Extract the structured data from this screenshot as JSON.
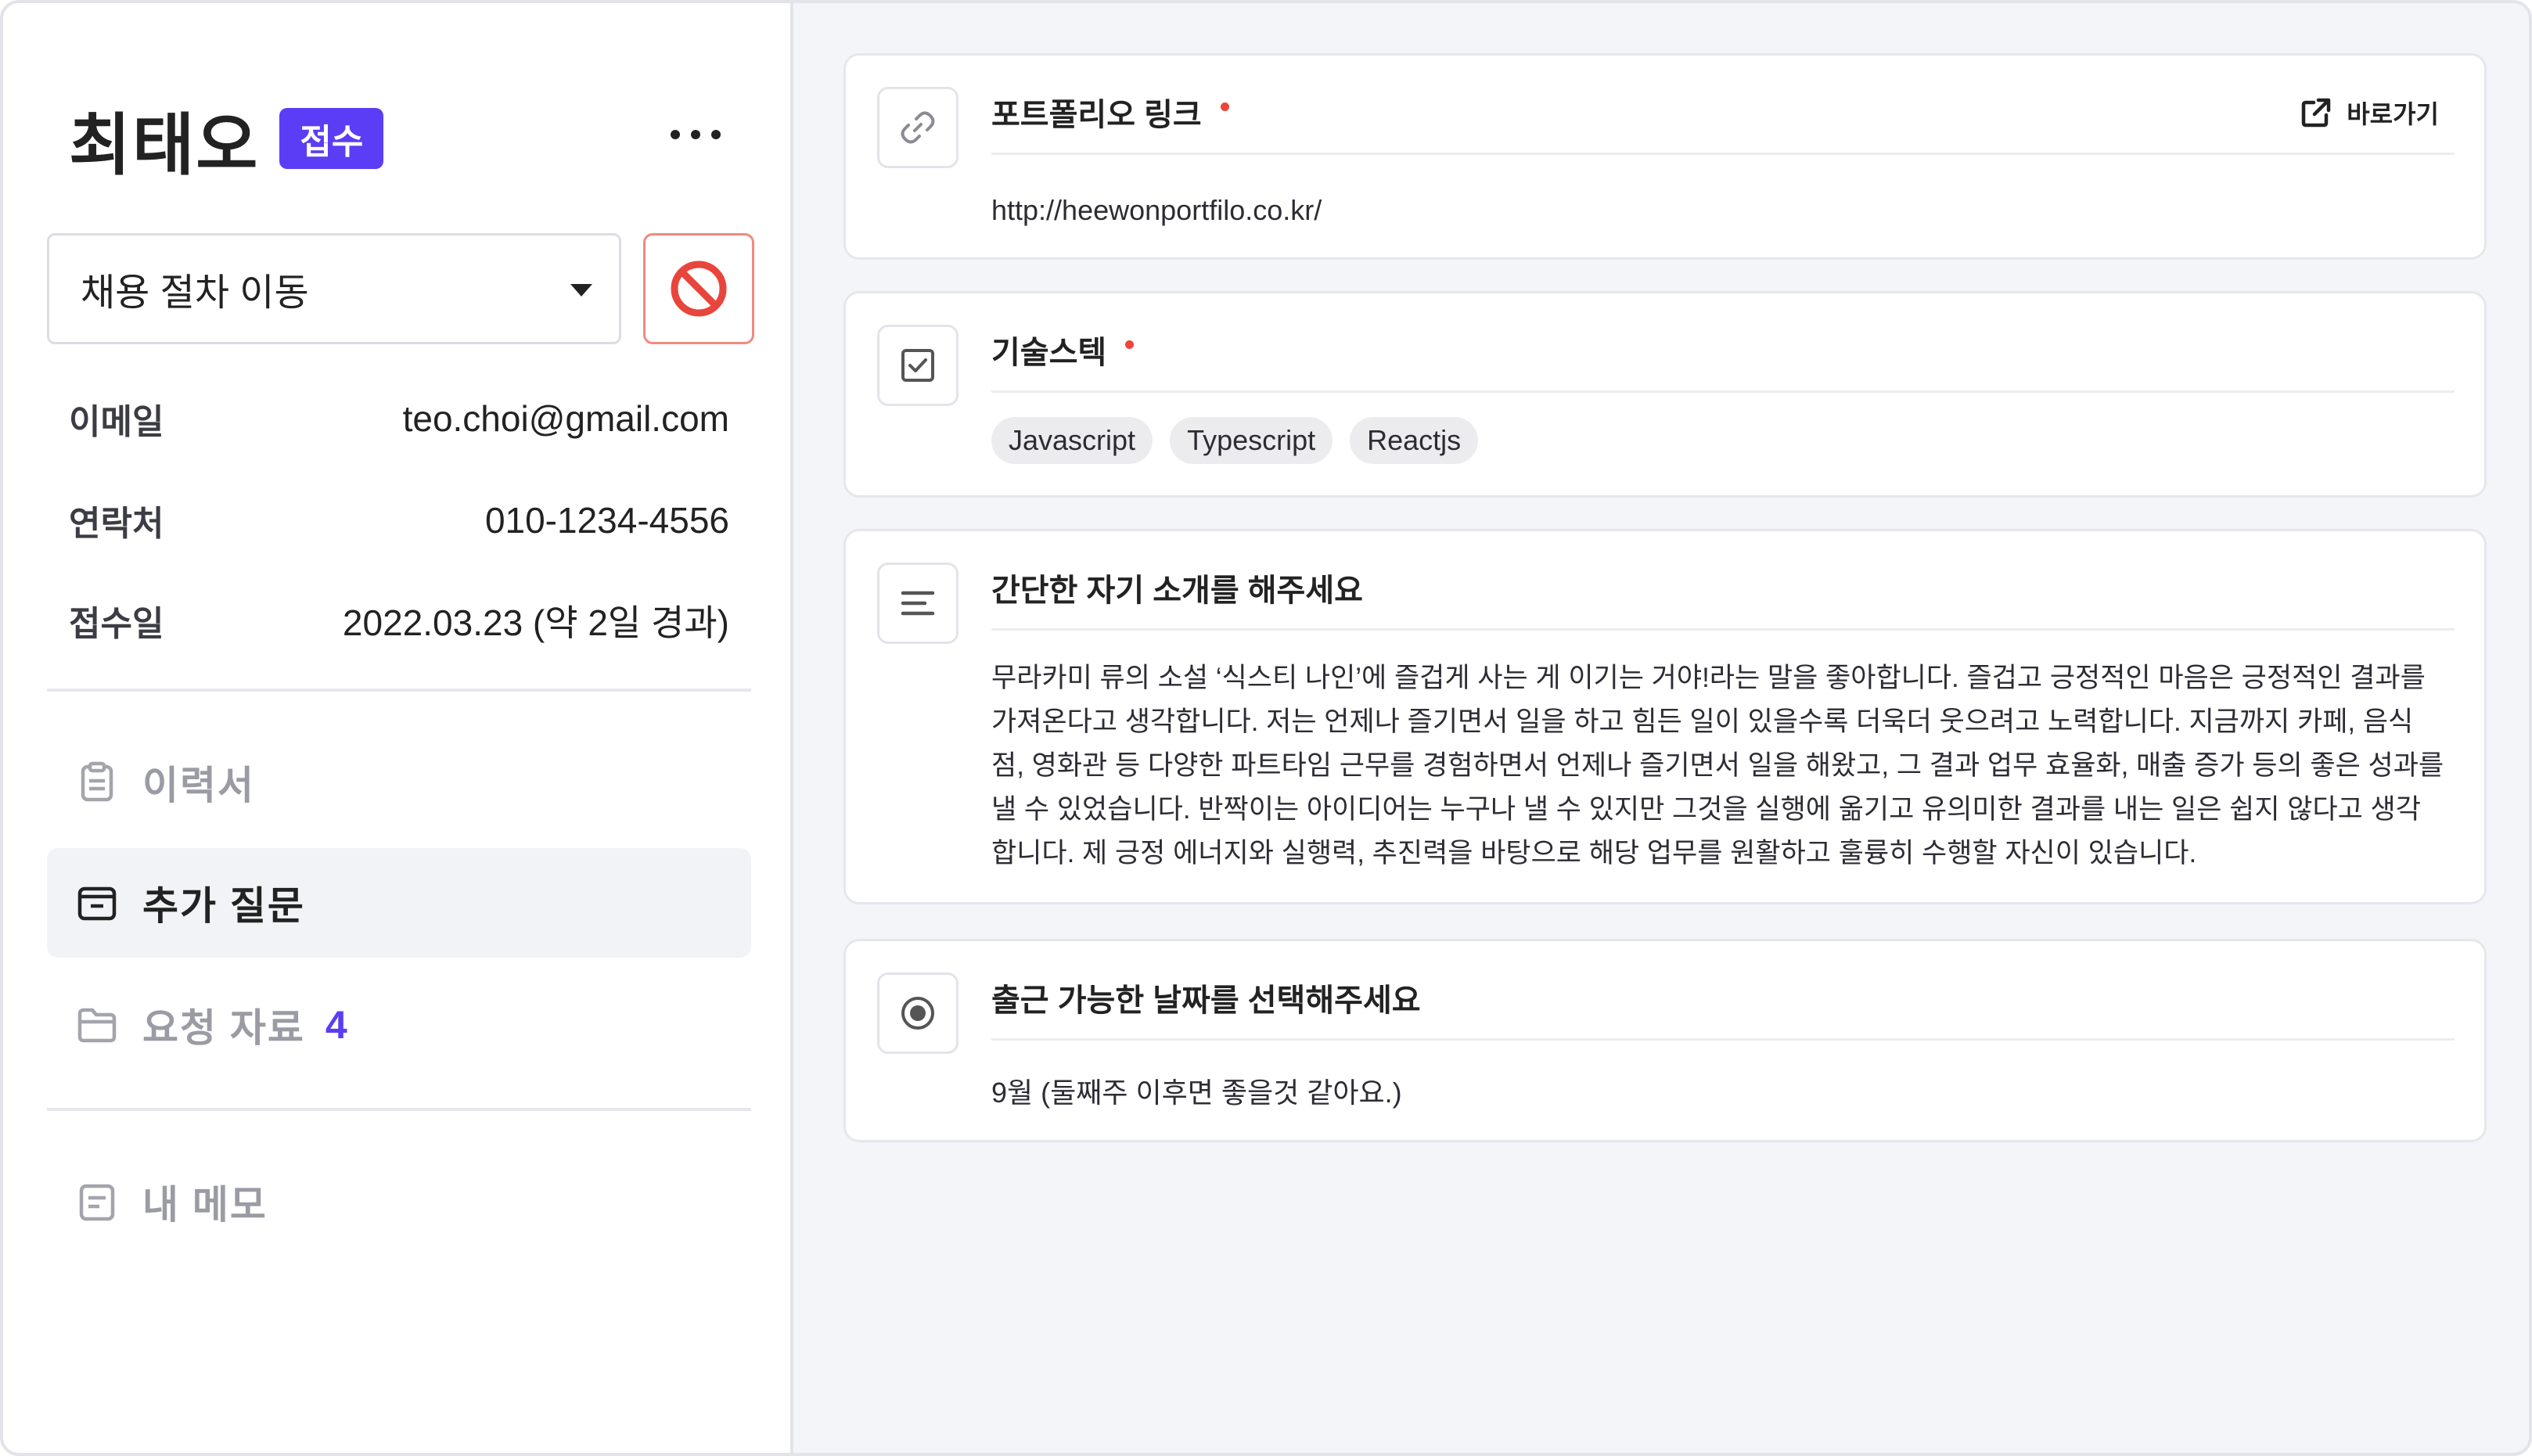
{
  "applicant": {
    "name": "최태오",
    "status_badge": "접수"
  },
  "stage_select": {
    "label": "채용 절차 이동"
  },
  "info": [
    {
      "key": "이메일",
      "value": "teo.choi@gmail.com"
    },
    {
      "key": "연락처",
      "value": "010-1234-4556"
    },
    {
      "key": "접수일",
      "value": "2022.03.23 (약 2일 경과)"
    }
  ],
  "nav": [
    {
      "label": "이력서",
      "icon": "clipboard-icon",
      "active": false
    },
    {
      "label": "추가 질문",
      "icon": "inbox-icon",
      "active": true
    },
    {
      "label": "요청 자료",
      "icon": "folder-icon",
      "active": false,
      "count": "4"
    },
    {
      "label": "내 메모",
      "icon": "memo-icon",
      "active": false
    }
  ],
  "cards": {
    "portfolio": {
      "title": "포트폴리오 링크",
      "icon": "link-icon",
      "shortcut_label": "바로가기",
      "value": "http://heewonportfilo.co.kr/"
    },
    "skills": {
      "title": "기술스텍",
      "icon": "checkbox-icon",
      "tags": [
        "Javascript",
        "Typescript",
        "Reactjs"
      ]
    },
    "intro": {
      "title": "간단한 자기 소개를 해주세요",
      "icon": "text-lines-icon",
      "lines": [
        "무라카미 류의 소설 ‘식스티 나인’에 즐겁게 사는 게 이기는 거야!라는 말을 좋아합니다. 즐겁고 긍정적인 마음은 긍정적인 결과를",
        "가져온다고 생각합니다. 저는 언제나 즐기면서 일을 하고 힘든 일이 있을수록 더욱더 웃으려고 노력합니다. 지금까지 카페, 음식",
        "점, 영화관 등 다양한 파트타임 근무를 경험하면서 언제나 즐기면서 일을 해왔고, 그 결과 업무 효율화, 매출 증가 등의 좋은 성과를",
        "낼 수 있었습니다. 반짝이는 아이디어는 누구나 낼 수 있지만 그것을 실행에 옮기고 유의미한 결과를 내는 일은 쉽지 않다고 생각",
        "합니다. 제 긍정 에너지와 실행력, 추진력을 바탕으로 해당 업무를 원활하고 훌륭히 수행할 자신이 있습니다."
      ]
    },
    "start_date": {
      "title": "출근 가능한 날짜를 선택해주세요",
      "icon": "radio-icon",
      "value": "9월 (둘째주 이후면 좋을것 같아요.)"
    }
  },
  "colors": {
    "accent": "#5b3df5",
    "required_dot": "#f04438",
    "block_button_border": "#f08a80",
    "block_icon": "#e8453c"
  }
}
